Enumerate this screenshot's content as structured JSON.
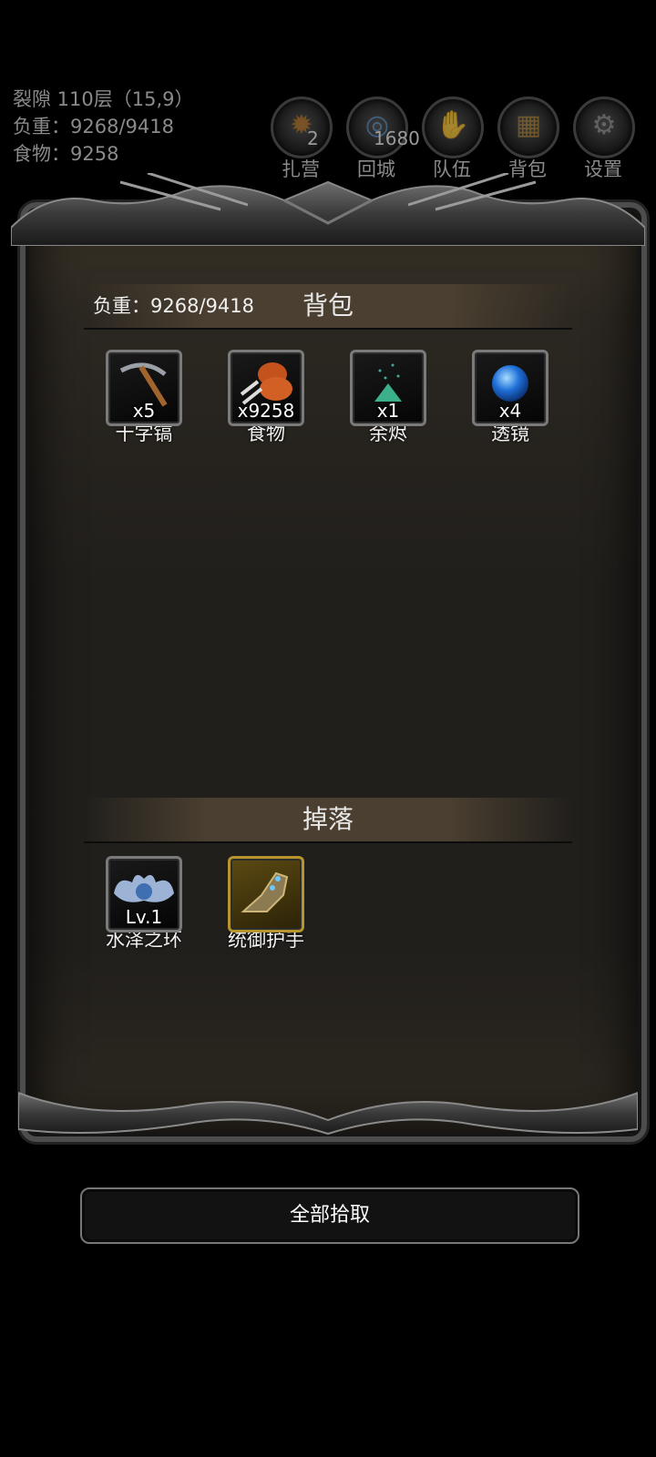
{
  "hud": {
    "location": "裂隙 110层（15,9）",
    "weight": "负重：9268/9418",
    "food": "食物：9258",
    "buttons": [
      {
        "label": "扎营",
        "badge": "2",
        "icon": "campfire-icon"
      },
      {
        "label": "回城",
        "badge": "1680",
        "icon": "portal-icon"
      },
      {
        "label": "队伍",
        "badge": "",
        "icon": "team-icon"
      },
      {
        "label": "背包",
        "badge": "",
        "icon": "backpack-icon"
      },
      {
        "label": "设置",
        "badge": "",
        "icon": "gear-icon"
      }
    ]
  },
  "bag": {
    "title": "背包",
    "weight": "负重：9268/9418",
    "items": [
      {
        "name": "十字镐",
        "count": "x5",
        "icon": "pickaxe-icon"
      },
      {
        "name": "食物",
        "count": "x9258",
        "icon": "meat-icon"
      },
      {
        "name": "余烬",
        "count": "x1",
        "icon": "ember-icon"
      },
      {
        "name": "透镜",
        "count": "x4",
        "icon": "lens-orb-icon"
      }
    ]
  },
  "drops": {
    "title": "掉落",
    "items": [
      {
        "name": "水泽之环",
        "level": "Lv.1",
        "icon": "ring-icon"
      },
      {
        "name": "统御护手",
        "level": "",
        "icon": "gauntlet-icon"
      }
    ]
  },
  "pickup_all": "全部拾取"
}
